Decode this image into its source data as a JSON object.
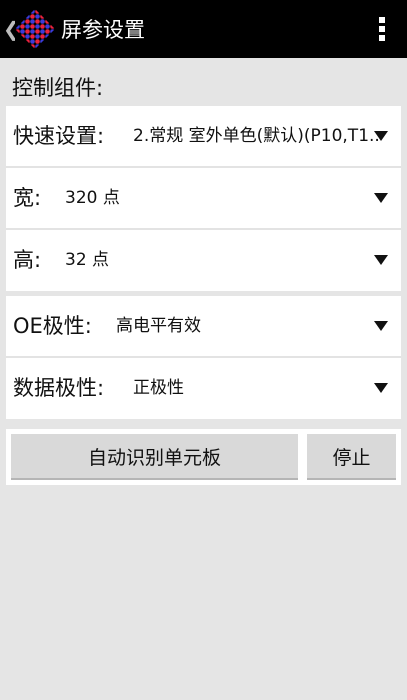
{
  "actionbar": {
    "back_glyph": "❮",
    "title": "屏参设置",
    "logo_icon": "app-logo-grid-icon",
    "menu_icon": "overflow-menu-icon"
  },
  "section": {
    "label": "控制组件:"
  },
  "rows": [
    {
      "label": "快速设置:",
      "value": "2.常规 室外单色(默认)(P10,T1..."
    },
    {
      "label": "宽:",
      "value": "320 点"
    },
    {
      "label": "高:",
      "value": "32 点"
    },
    {
      "label": "OE极性:",
      "value": "高电平有效"
    },
    {
      "label": "数据极性:",
      "value": "正极性"
    }
  ],
  "buttons": {
    "auto_detect": "自动识别单元板",
    "stop": "停止"
  },
  "colors": {
    "actionbar_bg": "#000000",
    "logo_red": "#e8213f",
    "logo_blue": "#3b3bd8",
    "background": "#e5e5e5",
    "card": "#ffffff",
    "button": "#d9d9d9"
  }
}
